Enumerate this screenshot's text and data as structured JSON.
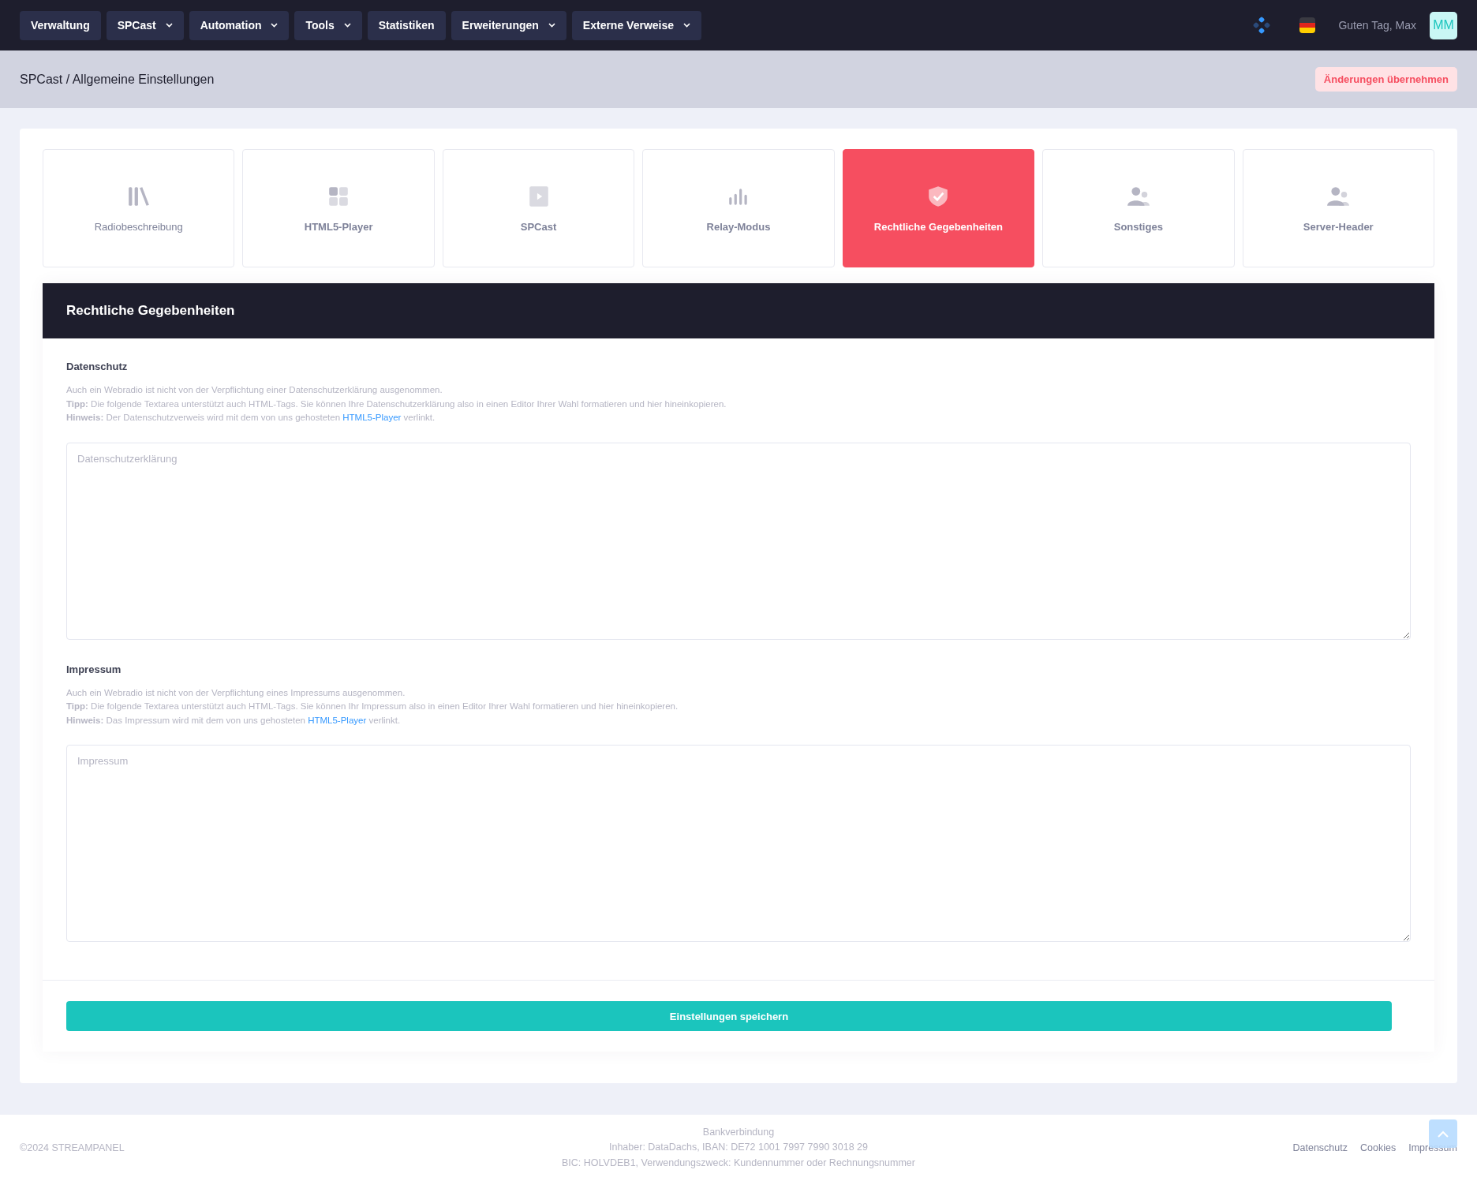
{
  "nav": {
    "items": [
      {
        "label": "Verwaltung",
        "dropdown": false
      },
      {
        "label": "SPCast",
        "dropdown": true
      },
      {
        "label": "Automation",
        "dropdown": true
      },
      {
        "label": "Tools",
        "dropdown": true
      },
      {
        "label": "Statistiken",
        "dropdown": false
      },
      {
        "label": "Erweiterungen",
        "dropdown": true
      },
      {
        "label": "Externe Verweise",
        "dropdown": true
      }
    ],
    "greeting": "Guten Tag, Max",
    "avatar": "MM"
  },
  "breadcrumb": "SPCast / Allgemeine Einstellungen",
  "apply_button": "Änderungen übernehmen",
  "tabs": [
    {
      "label": "Radiobeschreibung",
      "selected": false
    },
    {
      "label": "HTML5-Player",
      "selected": false
    },
    {
      "label": "SPCast",
      "selected": false
    },
    {
      "label": "Relay-Modus",
      "selected": false
    },
    {
      "label": "Rechtliche Gegebenheiten",
      "selected": true
    },
    {
      "label": "Sonstiges",
      "selected": false
    },
    {
      "label": "Server-Header",
      "selected": false
    }
  ],
  "section_title": "Rechtliche Gegebenheiten",
  "fields": [
    {
      "label": "Datenschutz",
      "help": [
        {
          "text": "Auch ein Webradio ist nicht von der Verpflichtung einer Datenschutzerklärung ausgenommen."
        },
        {
          "text": "**Tipp:** Die folgende Textarea unterstützt auch HTML-Tags. Sie können Ihre Datenschutzerklärung also in einen Editor Ihrer Wahl formatieren und hier hineinkopieren."
        },
        {
          "text": "**Hinweis:** Der Datenschutzverweis wird mit dem von uns gehosteten",
          "link": "HTML5-Player",
          "after": "verlinkt."
        }
      ],
      "placeholder": "Datenschutzerklärung"
    },
    {
      "label": "Impressum",
      "help": [
        {
          "text": "Auch ein Webradio ist nicht von der Verpflichtung eines Impressums ausgenommen."
        },
        {
          "text": "**Tipp:** Die folgende Textarea unterstützt auch HTML-Tags. Sie können Ihr Impressum also in einen Editor Ihrer Wahl formatieren und hier hineinkopieren."
        },
        {
          "text": "**Hinweis:** Das Impressum wird mit dem von uns gehosteten",
          "link": "HTML5-Player",
          "after": "verlinkt."
        }
      ],
      "placeholder": "Impressum"
    }
  ],
  "save_button": "Einstellungen speichern",
  "footer": {
    "copyright": "©2024 STREAMPANEL",
    "bank": [
      "Bankverbindung",
      "Inhaber: DataDachs, IBAN: DE72 1001 7997 7990 3018 29",
      "BIC: HOLVDEB1, Verwendungszweck: Kundennummer oder Rechnungsnummer"
    ],
    "links": [
      "Datenschutz",
      "Cookies",
      "Impressum"
    ]
  }
}
